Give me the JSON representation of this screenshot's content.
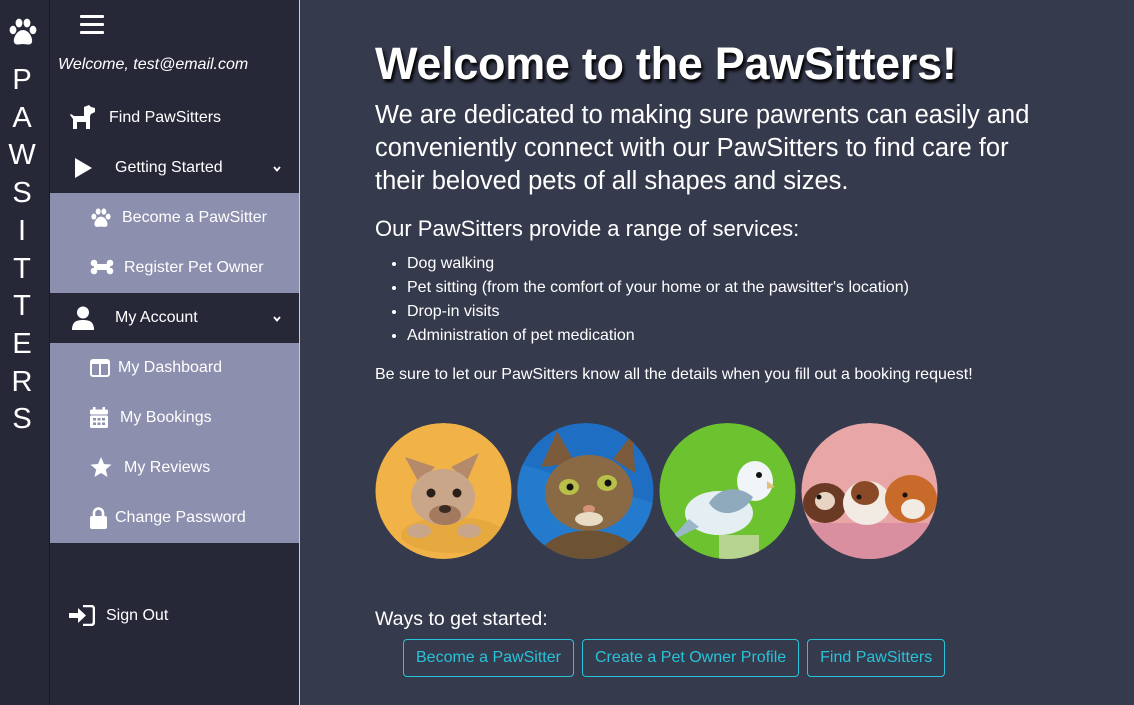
{
  "brand": {
    "letters": [
      "P",
      "A",
      "W",
      "S",
      "I",
      "T",
      "T",
      "E",
      "R",
      "S"
    ]
  },
  "sidebar": {
    "welcome": "Welcome, test@email.com",
    "items": [
      {
        "label": "Find PawSitters"
      },
      {
        "label": "Getting Started"
      },
      {
        "label": "Become a PawSitter"
      },
      {
        "label": "Register Pet Owner"
      },
      {
        "label": "My Account"
      },
      {
        "label": "My Dashboard"
      },
      {
        "label": "My Bookings"
      },
      {
        "label": "My Reviews"
      },
      {
        "label": "Change Password"
      }
    ],
    "sign_out": "Sign Out"
  },
  "main": {
    "title": "Welcome to the PawSitters!",
    "lead": "We are dedicated to making sure pawrents can easily and conveniently connect with our PawSitters to find care for their beloved pets of all shapes and sizes.",
    "services_heading": "Our PawSitters provide a range of services:",
    "services": [
      "Dog walking",
      "Pet sitting (from the comfort of your home or at the pawsitter's location)",
      "Drop-in visits",
      "Administration of pet medication"
    ],
    "note": "Be sure to let our PawSitters know all the details when you fill out a booking request!",
    "ways_heading": "Ways to get started:",
    "buttons": [
      {
        "label": "Become a PawSitter"
      },
      {
        "label": "Create a Pet Owner Profile"
      },
      {
        "label": "Find PawSitters"
      }
    ]
  },
  "colors": {
    "background": "#363a4d",
    "sidebar": "#262838",
    "submenu": "#8d8fae",
    "accent": "#27c3d9"
  }
}
